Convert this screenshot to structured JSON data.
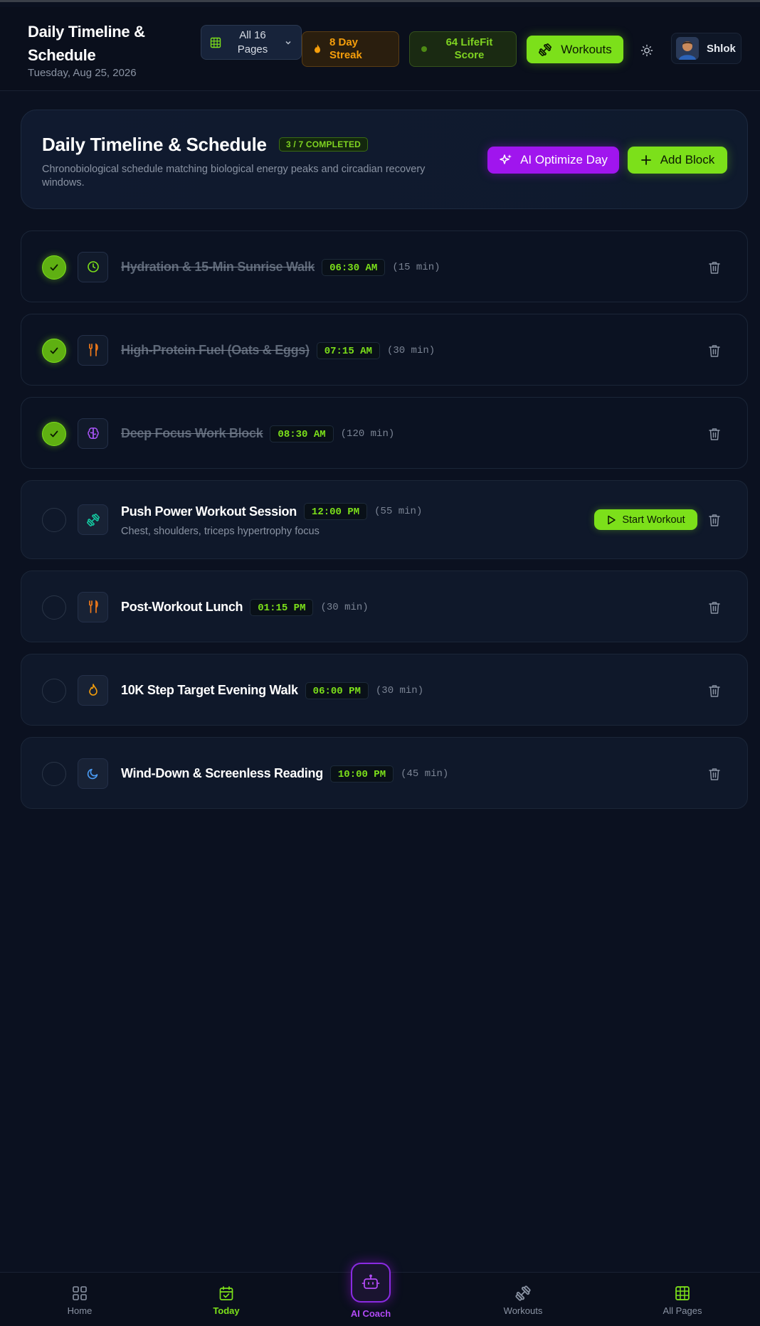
{
  "header": {
    "title": "Daily Timeline & Schedule",
    "date": "Tuesday, Aug 25, 2026",
    "pages_label": "All 16 Pages",
    "streak_label": "8 Day Streak",
    "score_label": "64 LifeFit Score",
    "workouts_label": "Workouts",
    "user_name": "Shlok"
  },
  "hero": {
    "title": "Daily Timeline & Schedule",
    "badge": "3 / 7 COMPLETED",
    "description": "Chronobiological schedule matching biological energy peaks and circadian recovery windows.",
    "ai_button": "AI Optimize Day",
    "add_button": "Add Block"
  },
  "blocks": [
    {
      "title": "Hydration & 15-Min Sunrise Walk",
      "time": "06:30 AM",
      "duration": "(15 min)",
      "done": true,
      "icon": "clock-icon",
      "icon_color": "#7ce01a"
    },
    {
      "title": "High-Protein Fuel (Oats & Eggs)",
      "time": "07:15 AM",
      "duration": "(30 min)",
      "done": true,
      "icon": "utensils-icon",
      "icon_color": "#f07a1a"
    },
    {
      "title": "Deep Focus Work Block",
      "time": "08:30 AM",
      "duration": "(120 min)",
      "done": true,
      "icon": "brain-icon",
      "icon_color": "#a855f7"
    },
    {
      "title": "Push Power Workout Session",
      "time": "12:00 PM",
      "duration": "(55 min)",
      "done": false,
      "icon": "dumbbell-icon",
      "icon_color": "#14c7a0",
      "subtitle": "Chest, shoulders, triceps hypertrophy focus",
      "action": "Start Workout"
    },
    {
      "title": "Post-Workout Lunch",
      "time": "01:15 PM",
      "duration": "(30 min)",
      "done": false,
      "icon": "utensils-icon",
      "icon_color": "#f07a1a"
    },
    {
      "title": "10K Step Target Evening Walk",
      "time": "06:00 PM",
      "duration": "(30 min)",
      "done": false,
      "icon": "flame-icon",
      "icon_color": "#f59e0b"
    },
    {
      "title": "Wind-Down & Screenless Reading",
      "time": "10:00 PM",
      "duration": "(45 min)",
      "done": false,
      "icon": "moon-icon",
      "icon_color": "#4a9cf5"
    }
  ],
  "nav": {
    "home": "Home",
    "today": "Today",
    "coach": "AI Coach",
    "workouts": "Workouts",
    "all_pages": "All Pages"
  },
  "colors": {
    "accent_green": "#7ce01a",
    "accent_purple": "#a015ee",
    "streak_orange": "#f59e0b",
    "background": "#0b1120"
  }
}
